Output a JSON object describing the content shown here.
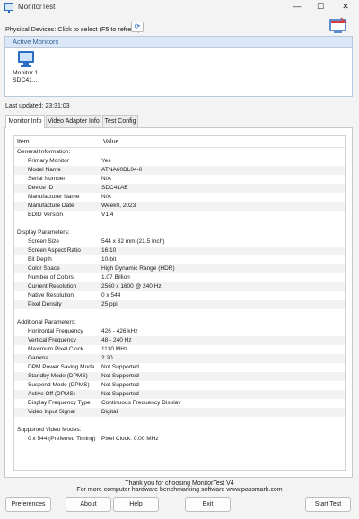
{
  "window": {
    "title": "MonitorTest",
    "minimize_glyph": "—",
    "maximize_glyph": "☐",
    "close_glyph": "✕"
  },
  "physical_devices_label": "Physical Devices: Click to select (F5 to refresh)",
  "active_monitors": {
    "header": "Active Monitors",
    "items": [
      {
        "name": "Monitor 1",
        "id": "SDC41..."
      }
    ]
  },
  "last_updated": "Last updated: 23:31:03",
  "tabs": [
    "Monitor Info",
    "Video Adapter Info",
    "Test Config"
  ],
  "table": {
    "columns": [
      "Item",
      "Value"
    ],
    "rows": [
      {
        "type": "group",
        "label": "General Information:"
      },
      {
        "type": "item",
        "k": "Primary Monitor",
        "v": "Yes"
      },
      {
        "type": "item",
        "k": "Model Name",
        "v": "ATNA60DL04-0"
      },
      {
        "type": "item",
        "k": "Serial Number",
        "v": "N/A"
      },
      {
        "type": "item",
        "k": "Device ID",
        "v": "SDC41AE"
      },
      {
        "type": "item",
        "k": "Manufacturer Name",
        "v": "N/A"
      },
      {
        "type": "item",
        "k": "Manufacture Date",
        "v": "Week0, 2023"
      },
      {
        "type": "item",
        "k": "EDID Version",
        "v": "V1.4"
      },
      {
        "type": "blank"
      },
      {
        "type": "group",
        "label": "Display Parameters:"
      },
      {
        "type": "item",
        "k": "Screen Size",
        "v": "544 x 32 mm (21.5 Inch)"
      },
      {
        "type": "item",
        "k": "Screen Aspect Ratio",
        "v": "16:10"
      },
      {
        "type": "item",
        "k": "Bit Depth",
        "v": "10-bit"
      },
      {
        "type": "item",
        "k": "Color Space",
        "v": "High Dynamic Range (HDR)"
      },
      {
        "type": "item",
        "k": "Number of Colors",
        "v": "1.07 Billion"
      },
      {
        "type": "item",
        "k": "Current Resolution",
        "v": "2560 x 1600 @ 240 Hz"
      },
      {
        "type": "item",
        "k": "Native Resolution",
        "v": "0 x 544"
      },
      {
        "type": "item",
        "k": "Pixel Density",
        "v": "25 ppi"
      },
      {
        "type": "blank"
      },
      {
        "type": "group",
        "label": "Additional Parameters:"
      },
      {
        "type": "item",
        "k": "Horizontal Frequency",
        "v": "426 - 426 kHz"
      },
      {
        "type": "item",
        "k": "Vertical Frequency",
        "v": "48 - 240 Hz"
      },
      {
        "type": "item",
        "k": "Maximum Pixel Clock",
        "v": "1130 MHz"
      },
      {
        "type": "item",
        "k": "Gamma",
        "v": "2.20"
      },
      {
        "type": "item",
        "k": "DPM Power Saving Mode",
        "v": "Not Supported"
      },
      {
        "type": "item",
        "k": "Standby Mode (DPMS)",
        "v": "Not Supported"
      },
      {
        "type": "item",
        "k": "Suspend Mode (DPMS)",
        "v": "Not Supported"
      },
      {
        "type": "item",
        "k": "Active Off (DPMS)",
        "v": "Not Supported"
      },
      {
        "type": "item",
        "k": "Display Frequency Type",
        "v": "Continuous Frequency Display"
      },
      {
        "type": "item",
        "k": "Video Input Signal",
        "v": "Digital"
      },
      {
        "type": "blank"
      },
      {
        "type": "group",
        "label": "Supported Video Modes:"
      },
      {
        "type": "item",
        "k": "0 x 544 (Preferred Timing)",
        "v": "Pixel Clock: 0.00 MHz"
      }
    ]
  },
  "footer": {
    "line1": "Thank you for choosing MonitorTest V4",
    "line2": "For more computer hardware benchmarking software www.passmark.com"
  },
  "buttons": {
    "preferences": "Preferences",
    "about": "About",
    "help": "Help",
    "exit": "Exit",
    "start_test": "Start Test"
  },
  "colors": {
    "accent": "#2b6cc4",
    "header_bg": "#dbe7f7",
    "alt_row": "#f2f2f2"
  }
}
